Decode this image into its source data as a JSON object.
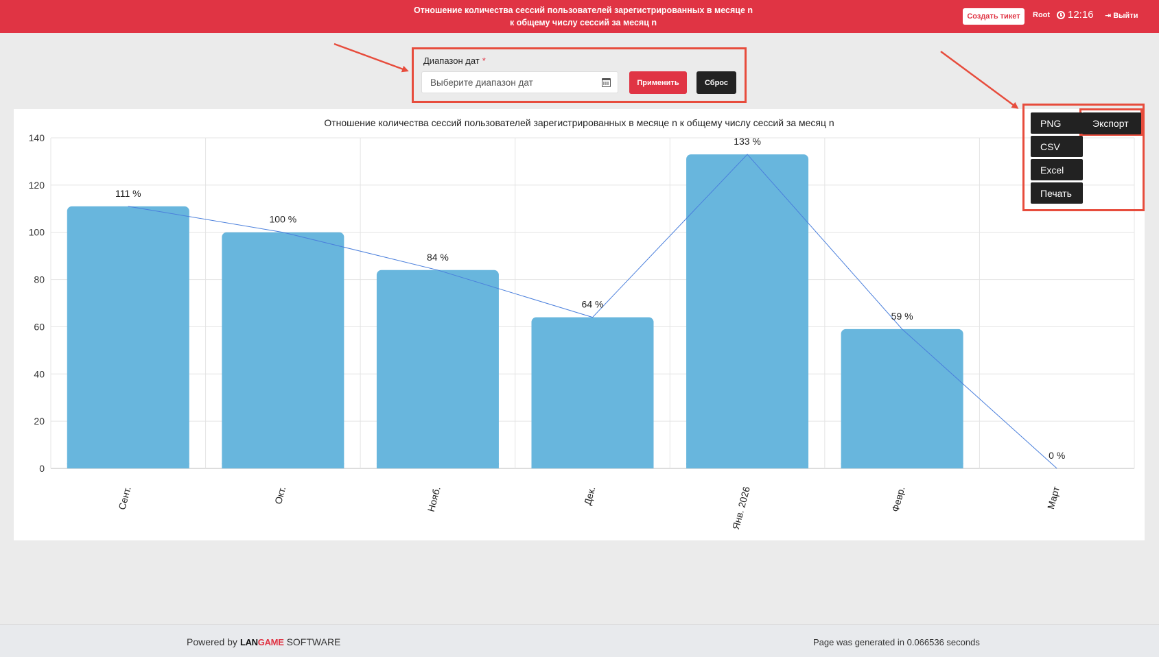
{
  "topbar": {
    "title": "Отношение количества сессий пользователей зарегистрированных в месяце n к общему числу сессий за месяц n",
    "ticket_label": "Создать тикет",
    "user_label": "Root",
    "clock_time": "12:16",
    "logout_label": "Выйти"
  },
  "filter": {
    "daterange_label": "Диапазон дат",
    "required_mark": "*",
    "daterange_placeholder": "Выберите диапазон дат",
    "apply_label": "Применить",
    "reset_label": "Сброс"
  },
  "export": {
    "main_label": "Экспорт",
    "options": [
      "PNG",
      "CSV",
      "Excel",
      "Печать"
    ]
  },
  "colors": {
    "accent": "#e03444",
    "bar": "#68b6dd",
    "line": "#4a7fdc",
    "annotation": "#e74c3c"
  },
  "footer": {
    "powered_by": "Powered by",
    "brand_left": "LAN",
    "brand_right": "GAME",
    "brand_suffix": "SOFTWARE",
    "generated": "Page was generated in 0.066536 seconds"
  },
  "chart_data": {
    "type": "bar",
    "title": "Отношение количества сессий пользователей зарегистрированных в месяце n к общему числу сессий за месяц n",
    "categories": [
      "Сент.",
      "Окт.",
      "Нояб.",
      "Дек.",
      "Янв. 2026",
      "Февр.",
      "Март"
    ],
    "values": [
      111,
      100,
      84,
      64,
      133,
      59,
      0
    ],
    "data_labels": [
      "111 %",
      "100 %",
      "84 %",
      "64 %",
      "133 %",
      "59 %",
      "0 %"
    ],
    "line_overlay": true,
    "ylim": [
      0,
      140
    ],
    "yticks": [
      0,
      20,
      40,
      60,
      80,
      100,
      120,
      140
    ],
    "grid": true,
    "xlabel": "",
    "ylabel": ""
  }
}
